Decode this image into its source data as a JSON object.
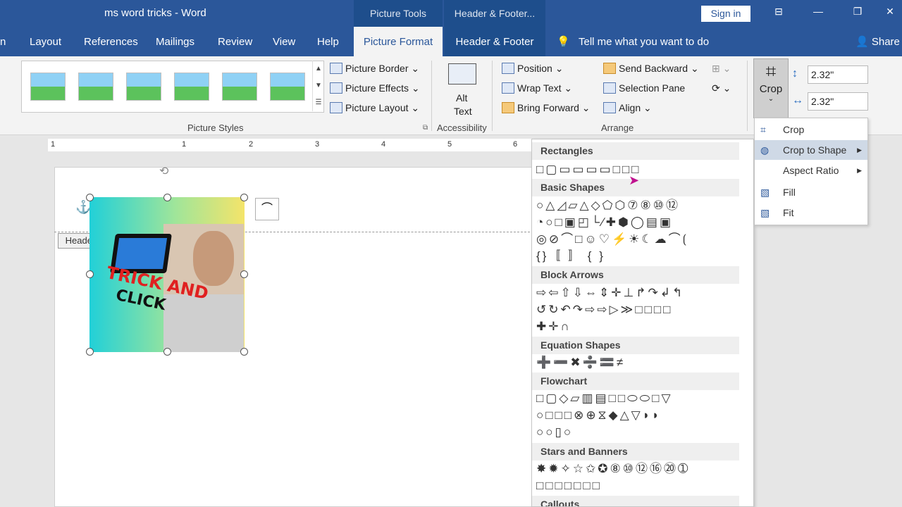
{
  "window": {
    "title": "ms word tricks  -  Word",
    "contextual": [
      "Picture Tools",
      "Header & Footer..."
    ],
    "sign_in": "Sign in",
    "controls": [
      "⊟",
      "—",
      "❐",
      "✕"
    ]
  },
  "tabs": [
    "n",
    "Layout",
    "References",
    "Mailings",
    "Review",
    "View",
    "Help",
    "Picture Format",
    "Header & Footer"
  ],
  "tell_me": "Tell me what you want to do",
  "share": "Share",
  "ribbon": {
    "picture_border": "Picture Border",
    "picture_effects": "Picture Effects",
    "picture_layout": "Picture Layout",
    "alt": "Alt",
    "text": "Text",
    "position": "Position",
    "wrap_text": "Wrap Text",
    "bring_forward": "Bring Forward",
    "send_backward": "Send Backward",
    "selection_pane": "Selection Pane",
    "align": "Align",
    "crop": "Crop",
    "height": "2.32\"",
    "width": "2.32\"",
    "groups": {
      "styles": "Picture Styles",
      "accessibility": "Accessibility",
      "arrange": "Arrange"
    }
  },
  "ruler_marks": [
    "1",
    "1",
    "2",
    "3",
    "4",
    "5",
    "6"
  ],
  "header_label": "Header",
  "image_text": {
    "trick": "TRICK AND",
    "click": "CLICK"
  },
  "shapes_menu": {
    "sections": [
      "Rectangles",
      "Basic Shapes",
      "Block Arrows",
      "Equation Shapes",
      "Flowchart",
      "Stars and Banners",
      "Callouts"
    ],
    "rows": [
      "□▢▭▭▭▭□□□",
      "○△◿▱△◇⬠⬡⑦⑧⑩⑫",
      "◔○□▣◰└∕✚⬢◯▤▣",
      "◎⊘⌒□☺♡⚡☀☾☁⌒⟮",
      "{}〚 〛 { }",
      "⇨⇦⇧⇩⇔⇕✛⊥↱↷↲↰",
      "↺↻↶↷⇨⇨▷≫□□□□",
      "✚✛∩",
      "➕➖✖➗🟰≠",
      "□▢◇▱▥▤□□⬭⬭□▽",
      "○□□□⊗⊕⧖◆△▽◗◗",
      "○○▯○",
      "✸✹✧☆✩✪⑧⑩⑫⑯⑳➀",
      "□□□□□□□"
    ]
  },
  "crop_menu": {
    "items": [
      {
        "label": "Crop",
        "icon": "⌗"
      },
      {
        "label": "Crop to Shape",
        "icon": "◍"
      },
      {
        "label": "Aspect Ratio",
        "icon": ""
      },
      {
        "label": "Fill",
        "icon": "▧"
      },
      {
        "label": "Fit",
        "icon": "▧"
      }
    ]
  }
}
